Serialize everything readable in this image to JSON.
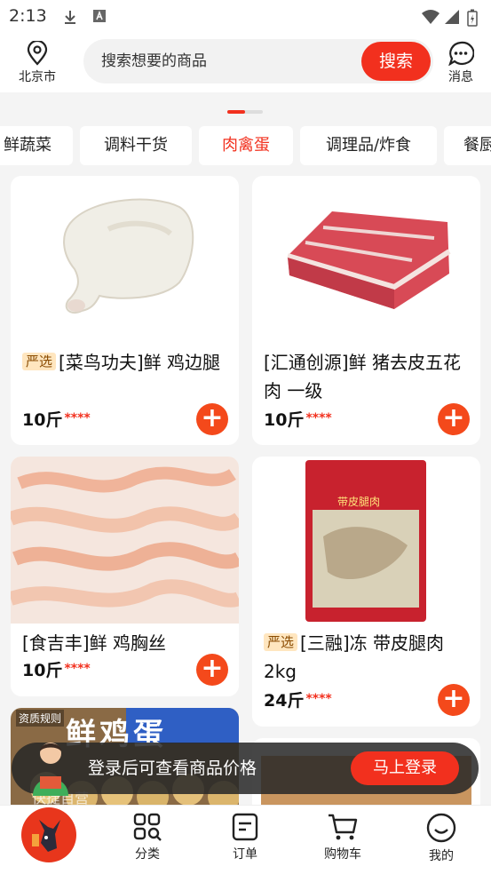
{
  "status_bar": {
    "time": "2:13"
  },
  "header": {
    "location": "北京市",
    "search_placeholder": "搜索想要的商品",
    "search_button": "搜索",
    "message_label": "消息"
  },
  "categories": [
    {
      "label": "鲜蔬菜",
      "active": false
    },
    {
      "label": "调料干货",
      "active": false
    },
    {
      "label": "肉禽蛋",
      "active": true
    },
    {
      "label": "调理品/炸食",
      "active": false
    },
    {
      "label": "餐厨",
      "active": false
    }
  ],
  "products": [
    {
      "tag": "严选",
      "title": "[菜鸟功夫]鲜 鸡边腿",
      "price": "10斤",
      "stars": "****"
    },
    {
      "tag": "",
      "title": "[汇通创源]鲜 猪去皮五花肉 一级",
      "price": "10斤",
      "stars": "****"
    },
    {
      "tag": "",
      "title": "[食吉丰]鲜 鸡胸丝",
      "price": "10斤",
      "stars": "****"
    },
    {
      "tag": "严选",
      "title": "[三融]冻 带皮腿肉2kg",
      "price": "24斤",
      "stars": "****"
    }
  ],
  "promo_card": {
    "badge": "资质规则",
    "headline": "鲜鸡蛋",
    "sub": "快捷自营"
  },
  "package_label": "带皮腿肉",
  "login_banner": {
    "text": "登录后可查看商品价格",
    "button": "马上登录"
  },
  "tabbar": {
    "items": [
      {
        "label": "分类",
        "icon": "grid-icon"
      },
      {
        "label": "订单",
        "icon": "order-icon"
      },
      {
        "label": "购物车",
        "icon": "cart-icon"
      },
      {
        "label": "我的",
        "icon": "profile-icon"
      }
    ]
  },
  "colors": {
    "accent": "#f2301e",
    "add_button": "#f4491b",
    "tag_bg": "#ffe6bf"
  }
}
